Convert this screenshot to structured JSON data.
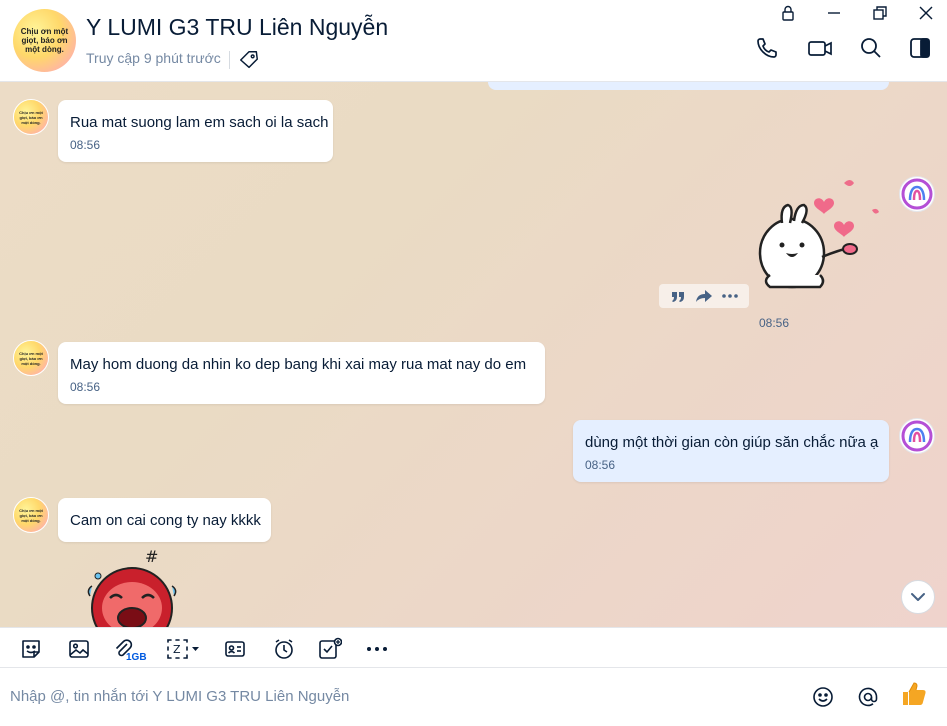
{
  "header": {
    "avatar_text": "Chịu ơn một giọt, báo ơn một dòng.",
    "title": "Y LUMI G3 TRU Liên Nguyễn",
    "last_seen": "Truy cập 9 phút trước"
  },
  "messages": [
    {
      "side": "left",
      "text": "Rua mat suong lam em sach oi la sach",
      "time": "08:56"
    },
    {
      "side": "right",
      "type": "sticker",
      "time": "08:56"
    },
    {
      "side": "left",
      "text": "May hom duong da nhin ko dep bang khi xai may rua mat nay do em",
      "time": "08:56"
    },
    {
      "side": "right",
      "text": "dùng một thời gian còn giúp săn chắc nữa ạ",
      "time": "08:56"
    },
    {
      "side": "left",
      "text": "Cam on cai cong ty nay kkkk"
    }
  ],
  "toolbar": {
    "attachment_quota": "1GB"
  },
  "composer": {
    "placeholder": "Nhập @, tin nhắn tới Y LUMI G3 TRU Liên Nguyễn"
  },
  "icons": {
    "window": [
      "lock-icon",
      "minimize-icon",
      "restore-icon",
      "close-icon"
    ],
    "header": [
      "phone-icon",
      "video-icon",
      "search-icon",
      "sidebar-toggle-icon"
    ],
    "toolbar": [
      "sticker-icon",
      "image-icon",
      "attachment-icon",
      "screenshot-icon",
      "contact-card-icon",
      "reminder-icon",
      "task-icon",
      "more-icon"
    ],
    "composer": [
      "emoji-icon",
      "mention-icon",
      "thumbs-up-icon"
    ]
  },
  "colors": {
    "accent": "#005ae0",
    "my_bubble": "#e5efff",
    "their_bubble": "#ffffff",
    "thumbs_up": "#f5a623"
  }
}
